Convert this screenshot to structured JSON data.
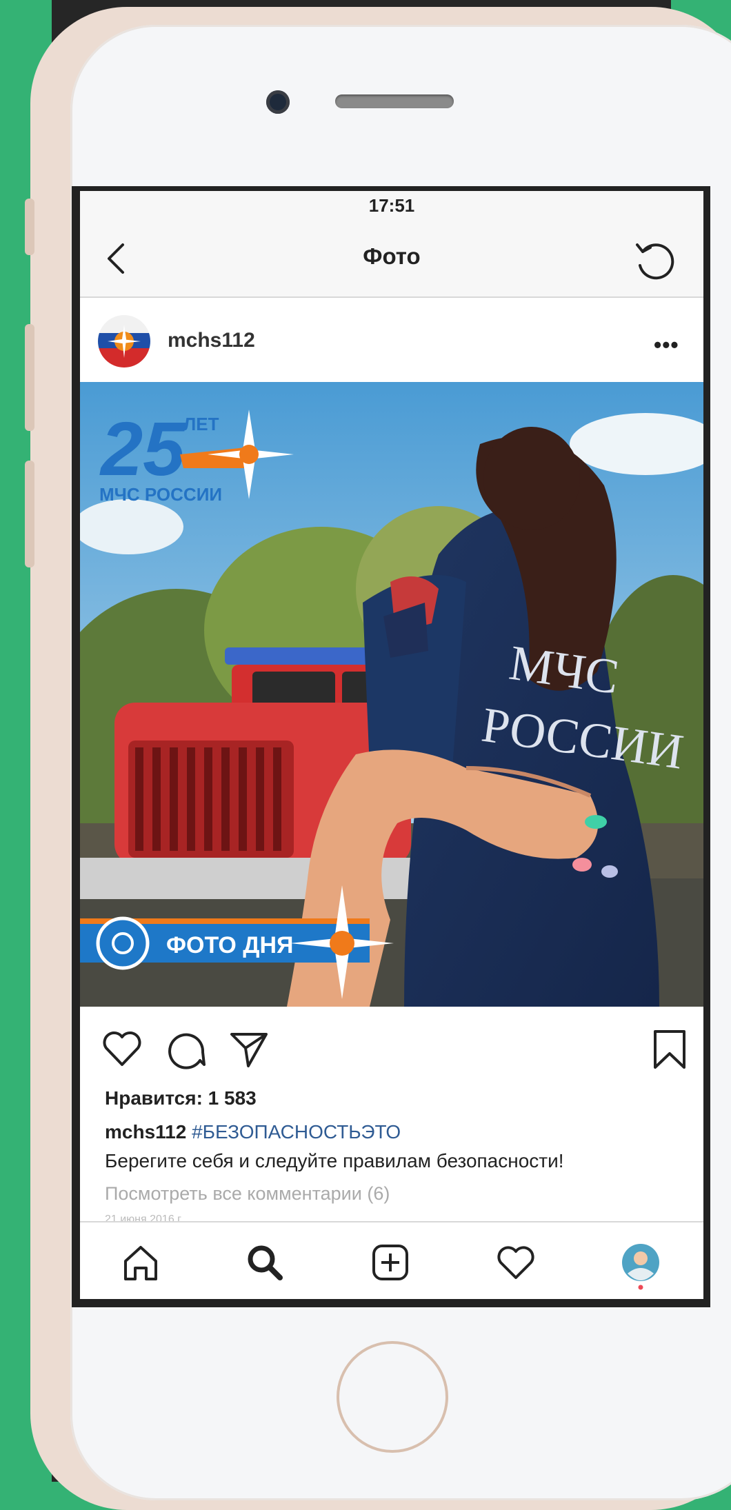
{
  "status": {
    "time": "17:51"
  },
  "nav": {
    "title": "Фото"
  },
  "post": {
    "username": "mchs112",
    "more": "•••",
    "photo_overlay": {
      "badge_years": "25",
      "badge_let": "ЛЕТ",
      "badge_org": "МЧС РОССИИ",
      "banner": "ФОТО ДНЯ",
      "jacket_line1": "МЧС",
      "jacket_line2": "РОССИИ"
    },
    "likes": "Нравится: 1 583",
    "caption_user": "mchs112",
    "caption_tag": "#БЕЗОПАСНОСТЬЭТО",
    "caption_text": "Берегите себя и следуйте правилам безопасности!",
    "view_comments": "Посмотреть все комментарии (6)",
    "date": "21 июня 2016 г."
  },
  "icons": [
    "back-icon",
    "refresh-icon",
    "more-icon",
    "heart-icon",
    "comment-icon",
    "share-icon",
    "bookmark-icon",
    "home-icon",
    "search-icon",
    "add-icon",
    "activity-icon",
    "profile-icon"
  ],
  "colors": {
    "background": "#34b274",
    "hashtag": "#2f5b93",
    "notification_dot": "#ed4956"
  }
}
